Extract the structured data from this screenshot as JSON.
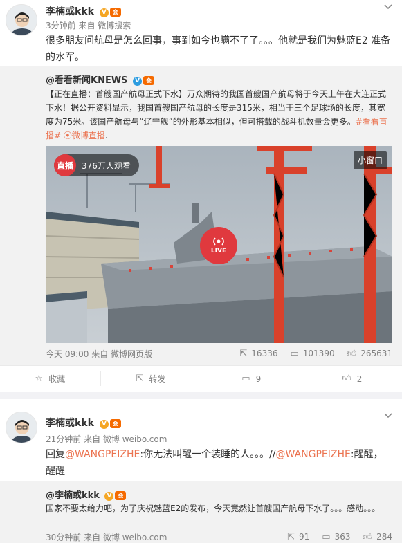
{
  "post1": {
    "author": "李楠或kkk",
    "v_badge": "V",
    "level_badge": "会",
    "meta": "3分钟前 来自 微博搜索",
    "text": "很多朋友问航母是怎么回事，事到如今也瞒不了了。。。他就是我们为魅蓝E2 准备的水军。",
    "retweet": {
      "author": "@看看新闻KNEWS",
      "text_main": "【正在直播：首艘国产航母正式下水】万众期待的我国首艘国产航母将于今天上午在大连正式下水！据公开资料显示，我国首艘国产航母的长度是315米，相当于三个足球场的长度，其宽度为75米。该国产航母与“辽宁舰”的外形基本相似，但可搭载的战斗机数量会更多。",
      "tag1": "#看看直播#",
      "tag2": "微博直播",
      "tag2_suffix": ".",
      "video": {
        "live_label": "直播",
        "viewers": "376万人观看",
        "mini_window": "小窗口",
        "center_label": "LIVE"
      },
      "footer": {
        "time_source": "今天 09:00 来自 微博网页版",
        "reposts": "16336",
        "comments": "101390",
        "likes": "265631"
      }
    },
    "actions": {
      "favorite": "收藏",
      "repost": "转发",
      "comment": "9",
      "like": "2"
    }
  },
  "post2": {
    "author": "李楠或kkk",
    "v_badge": "V",
    "level_badge": "会",
    "meta": "21分钟前 来自 微博 weibo.com",
    "text_prefix": "回复",
    "mention1": "@WANGPEIZHE",
    "text_mid": ":你无法叫醒一个装睡的人。。。//",
    "mention2": "@WANGPEIZHE",
    "text_end": ":醒醒，醒醒",
    "quote": {
      "author": "@李楠或kkk",
      "text": "国家不要太给力吧，为了庆祝魅蓝E2的发布，今天竟然让首艘国产航母下水了。。。感动。。。",
      "footer": {
        "time_source": "30分钟前 来自 微博 weibo.com",
        "reposts": "91",
        "comments": "363",
        "likes": "284"
      }
    }
  },
  "colors": {
    "link": "#eb7350",
    "live_red": "#e0393e",
    "badge_orange": "#f5a623"
  }
}
